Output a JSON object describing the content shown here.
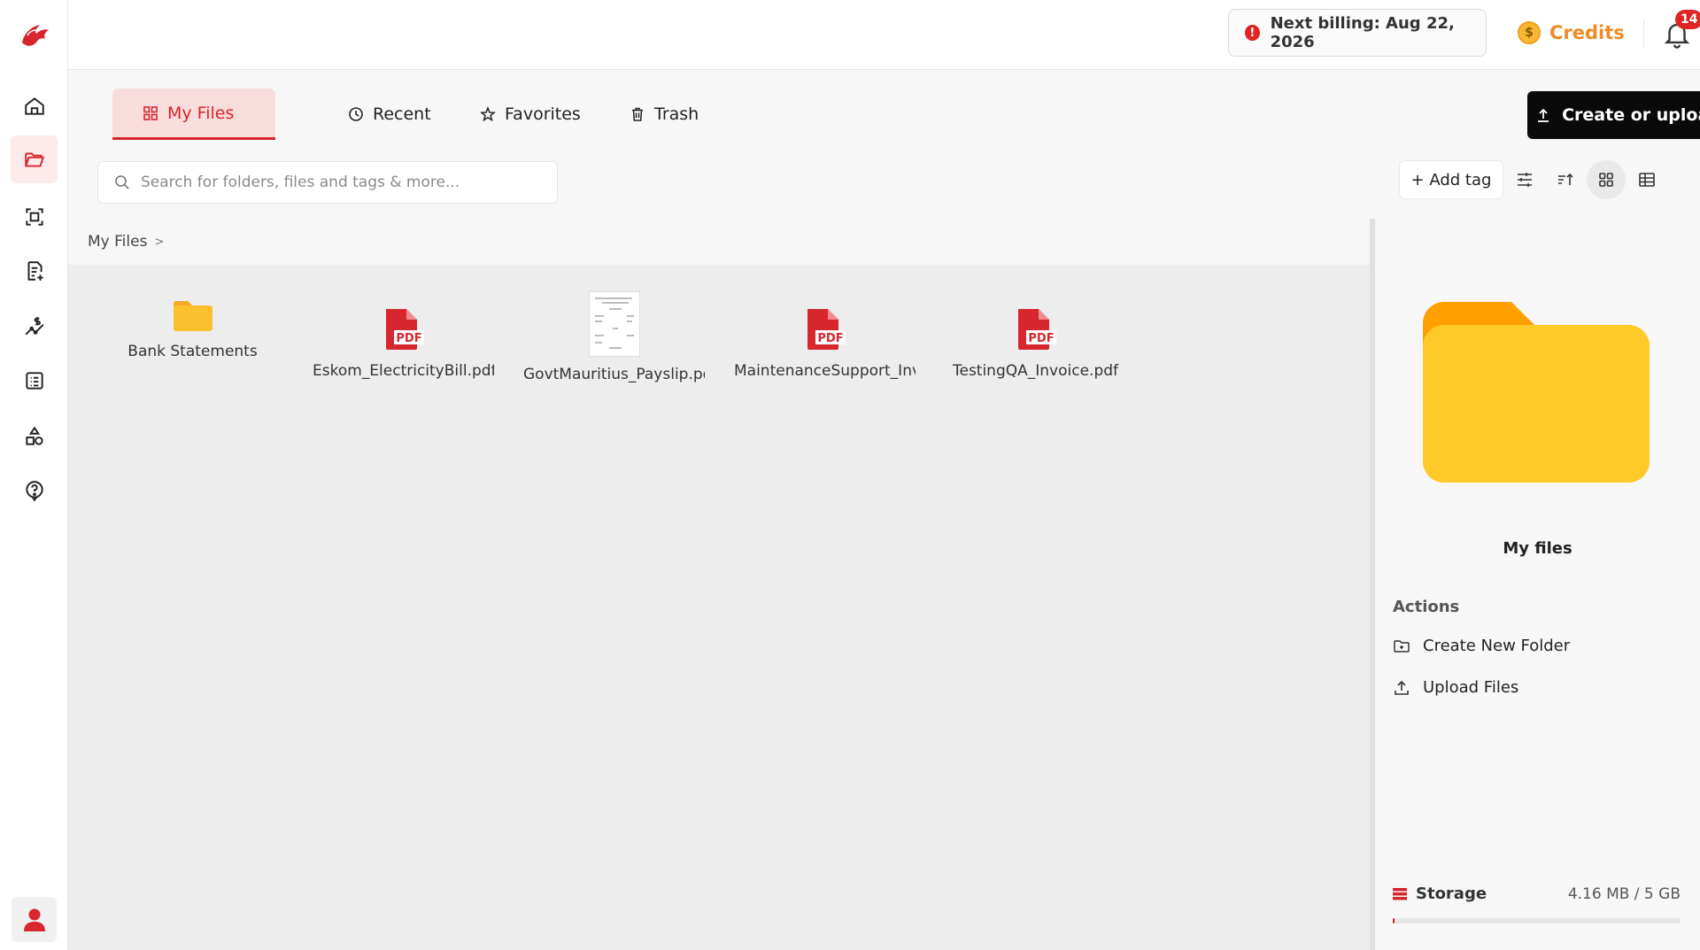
{
  "topbar": {
    "billing_text": "Next billing: Aug 22, 2026",
    "credits_label": "Credits",
    "notifications_count": "14"
  },
  "tabs": [
    {
      "label": "My Files",
      "active": true
    },
    {
      "label": "Recent",
      "active": false
    },
    {
      "label": "Favorites",
      "active": false
    },
    {
      "label": "Trash",
      "active": false
    }
  ],
  "create_button_label": "Create or upload",
  "search": {
    "placeholder": "Search for folders, files and tags & more...",
    "value": ""
  },
  "add_tag_label": "+ Add tag",
  "breadcrumb": {
    "root": "My Files",
    "separator": ">"
  },
  "items": [
    {
      "name": "Bank Statements",
      "kind": "folder"
    },
    {
      "name": "Eskom_ElectricityBill.pdf",
      "kind": "pdf"
    },
    {
      "name": "GovtMauritius_Payslip.pdf",
      "kind": "image"
    },
    {
      "name": "MaintenanceSupport_Invoice.pdf",
      "kind": "pdf"
    },
    {
      "name": "TestingQA_Invoice.pdf",
      "kind": "pdf"
    }
  ],
  "pdf_badge": "PDF",
  "right_panel": {
    "title": "My files",
    "actions_heading": "Actions",
    "actions": [
      {
        "label": "Create New Folder",
        "icon": "folder-plus-icon"
      },
      {
        "label": "Upload Files",
        "icon": "upload-icon"
      }
    ],
    "storage_label": "Storage",
    "storage_value": "4.16 MB / 5 GB",
    "storage_used_fraction": 0.001
  },
  "colors": {
    "accent": "#d7262e",
    "folder": "#fbc02d",
    "credits": "#f08a24"
  }
}
